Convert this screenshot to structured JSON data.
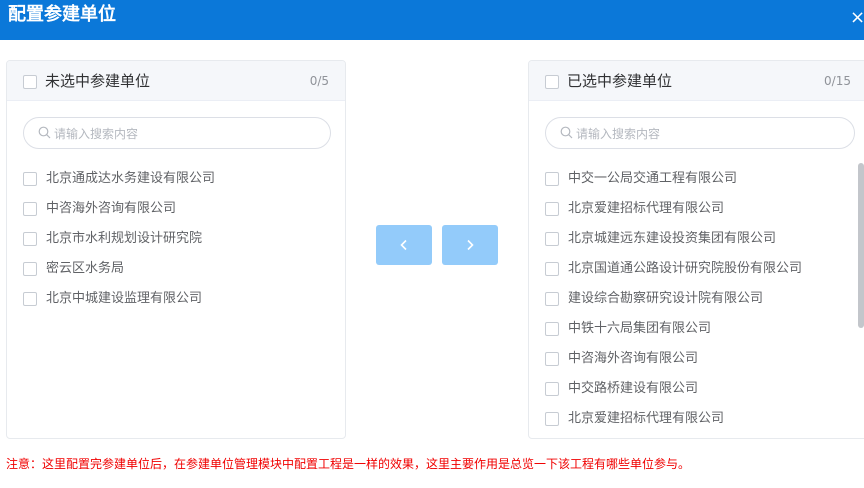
{
  "dialog": {
    "title": "配置参建单位",
    "close_glyph": "×"
  },
  "left_panel": {
    "title": "未选中参建单位",
    "count": "0/5",
    "search_placeholder": "请输入搜索内容",
    "items": [
      "北京通成达水务建设有限公司",
      "中咨海外咨询有限公司",
      "北京市水利规划设计研究院",
      "密云区水务局",
      "北京中城建设监理有限公司"
    ]
  },
  "right_panel": {
    "title": "已选中参建单位",
    "count": "0/15",
    "search_placeholder": "请输入搜索内容",
    "items": [
      "中交一公局交通工程有限公司",
      "北京爱建招标代理有限公司",
      "北京城建远东建设投资集团有限公司",
      "北京国道通公路设计研究院股份有限公司",
      "建设综合勘察研究设计院有限公司",
      "中铁十六局集团有限公司",
      "中咨海外咨询有限公司",
      "中交路桥建设有限公司",
      "北京爱建招标代理有限公司"
    ]
  },
  "transfer_buttons": {
    "prev_icon": "chevron-left-icon",
    "next_icon": "chevron-right-icon"
  },
  "note": "注意：这里配置完参建单位后，在参建单位管理模块中配置工程是一样的效果，这里主要作用是总览一下该工程有哪些单位参与。",
  "colors": {
    "header": "#0b78d9",
    "button": "#93cbfa",
    "note": "#f00000"
  }
}
